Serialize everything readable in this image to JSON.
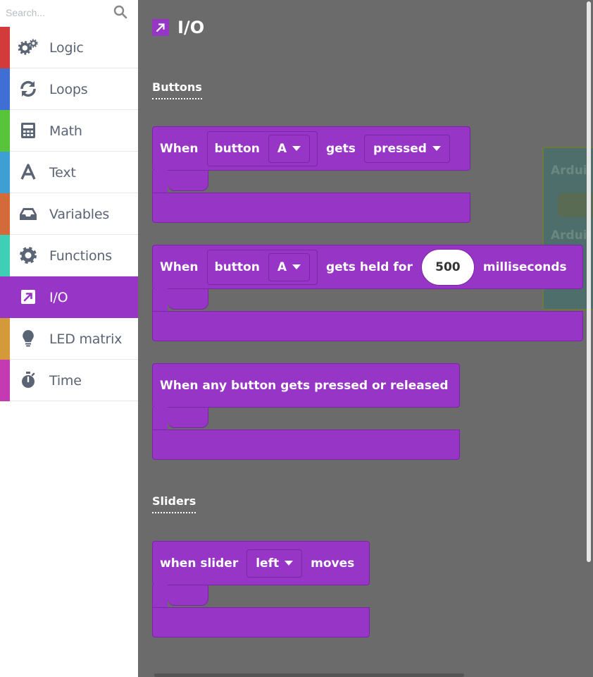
{
  "search": {
    "placeholder": "Search..."
  },
  "categories": [
    {
      "label": "Logic",
      "color": "#d33a3a",
      "icon": "gears-icon"
    },
    {
      "label": "Loops",
      "color": "#3f6ed4",
      "icon": "refresh-icon"
    },
    {
      "label": "Math",
      "color": "#58c43a",
      "icon": "calculator-icon"
    },
    {
      "label": "Text",
      "color": "#3d9fd4",
      "icon": "letter-a-icon"
    },
    {
      "label": "Variables",
      "color": "#d4693a",
      "icon": "inbox-icon"
    },
    {
      "label": "Functions",
      "color": "#3fcfb5",
      "icon": "gear-icon"
    },
    {
      "label": "I/O",
      "color": "#9635c6",
      "icon": "arrow-up-right-icon",
      "selected": true
    },
    {
      "label": "LED matrix",
      "color": "#d49a3a",
      "icon": "lightbulb-icon"
    },
    {
      "label": "Time",
      "color": "#c43ab3",
      "icon": "stopwatch-icon"
    }
  ],
  "flyout": {
    "heading": "I/O",
    "accent": "#9635c6",
    "background": "#6b6b6b",
    "sections": {
      "buttons": "Buttons",
      "sliders": "Sliders"
    },
    "ghost_block": {
      "line1": "Ardui",
      "line2": "Ardui"
    },
    "blocks": {
      "button_pressed": {
        "when": "When",
        "button": "button",
        "button_value": "A",
        "gets": "gets",
        "action_value": "pressed"
      },
      "button_held": {
        "when": "When",
        "button": "button",
        "button_value": "A",
        "gets_held_for": "gets held for",
        "duration": "500",
        "unit": "milliseconds"
      },
      "any_button": {
        "text": "When any button gets pressed or released"
      },
      "slider_moves": {
        "when_slider": "when slider",
        "slider_value": "left",
        "moves": "moves"
      }
    }
  }
}
